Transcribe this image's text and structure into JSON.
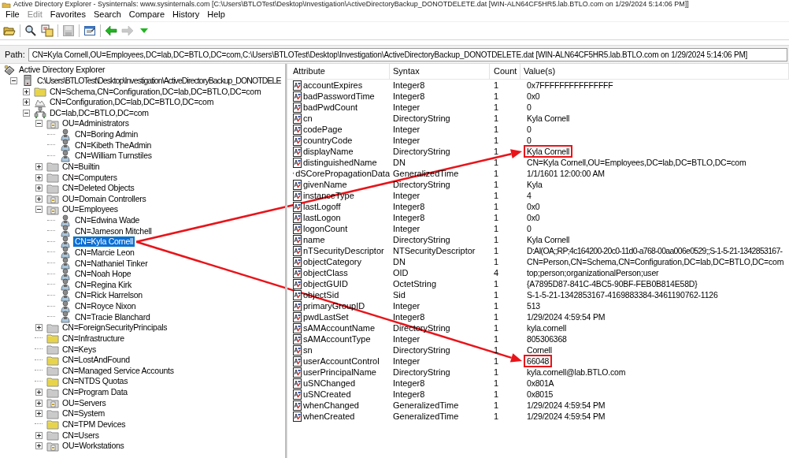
{
  "window": {
    "title": "Active Directory Explorer - Sysinternals: www.sysinternals.com [C:\\Users\\BTLOTest\\Desktop\\Investigation\\ActiveDirectoryBackup_DONOTDELETE.dat [WIN-ALN64CF5HR5.lab.BTLO.com on 1/29/2024 5:14:06 PM]]"
  },
  "menu": [
    {
      "label": "File",
      "disabled": false
    },
    {
      "label": "Edit",
      "disabled": true
    },
    {
      "label": "Favorites",
      "disabled": false
    },
    {
      "label": "Search",
      "disabled": false
    },
    {
      "label": "Compare",
      "disabled": false
    },
    {
      "label": "History",
      "disabled": false
    },
    {
      "label": "Help",
      "disabled": false
    }
  ],
  "toolbar": [
    {
      "kind": "open",
      "disabled": false
    },
    {
      "kind": "separator"
    },
    {
      "kind": "find",
      "disabled": false
    },
    {
      "kind": "compare",
      "disabled": false
    },
    {
      "kind": "separator"
    },
    {
      "kind": "save",
      "disabled": true
    },
    {
      "kind": "separator"
    },
    {
      "kind": "properties",
      "disabled": false
    },
    {
      "kind": "separator"
    },
    {
      "kind": "back",
      "disabled": false
    },
    {
      "kind": "forward",
      "disabled": true
    },
    {
      "kind": "history",
      "disabled": false
    }
  ],
  "path": {
    "label": "Path:",
    "value": "CN=Kyla Cornell,OU=Employees,DC=lab,DC=BTLO,DC=com,C:\\Users\\BTLOTest\\Desktop\\Investigation\\ActiveDirectoryBackup_DONOTDELETE.dat [WIN-ALN64CF5HR5.lab.BTLO.com on 1/29/2024 5:14:06 PM]"
  },
  "tree": [
    {
      "label": "Active Directory Explorer",
      "kind": "explorer",
      "selected": false,
      "children": [
        {
          "label": "C:\\Users\\BTLOTest\\Desktop\\Investigation\\ActiveDirectoryBackup_DONOTDELE",
          "kind": "database",
          "expanded": true,
          "selected": false,
          "children": [
            {
              "label": "CN=Schema,CN=Configuration,DC=lab,DC=BTLO,DC=com",
              "kind": "folder",
              "expanded": false,
              "selected": false
            },
            {
              "label": "CN=Configuration,DC=lab,DC=BTLO,DC=com",
              "kind": "config",
              "expanded": false,
              "selected": false
            },
            {
              "label": "DC=lab,DC=BTLO,DC=com",
              "kind": "domain",
              "expanded": true,
              "selected": false,
              "children": [
                {
                  "label": "OU=Administrators",
                  "kind": "ou",
                  "expanded": true,
                  "selected": false,
                  "children": [
                    {
                      "label": "CN=Boring Admin",
                      "kind": "user",
                      "selected": false
                    },
                    {
                      "label": "CN=Kibeth TheAdmin",
                      "kind": "user",
                      "selected": false
                    },
                    {
                      "label": "CN=William Turnstiles",
                      "kind": "user",
                      "selected": false
                    }
                  ]
                },
                {
                  "label": "CN=Builtin",
                  "kind": "container",
                  "expanded": false,
                  "selected": false
                },
                {
                  "label": "CN=Computers",
                  "kind": "container",
                  "expanded": false,
                  "selected": false
                },
                {
                  "label": "CN=Deleted Objects",
                  "kind": "container",
                  "expanded": false,
                  "selected": false
                },
                {
                  "label": "OU=Domain Controllers",
                  "kind": "ou",
                  "expanded": false,
                  "selected": false
                },
                {
                  "label": "OU=Employees",
                  "kind": "ou",
                  "expanded": true,
                  "selected": false,
                  "children": [
                    {
                      "label": "CN=Edwina Wade",
                      "kind": "user",
                      "selected": false
                    },
                    {
                      "label": "CN=Jameson Mitchell",
                      "kind": "user",
                      "selected": false
                    },
                    {
                      "label": "CN=Kyla Cornell",
                      "kind": "user",
                      "selected": true
                    },
                    {
                      "label": "CN=Marcie Leon",
                      "kind": "user",
                      "selected": false
                    },
                    {
                      "label": "CN=Nathaniel Tinker",
                      "kind": "user",
                      "selected": false
                    },
                    {
                      "label": "CN=Noah Hope",
                      "kind": "user",
                      "selected": false
                    },
                    {
                      "label": "CN=Regina Kirk",
                      "kind": "user",
                      "selected": false
                    },
                    {
                      "label": "CN=Rick Harrelson",
                      "kind": "user",
                      "selected": false
                    },
                    {
                      "label": "CN=Royce Nixon",
                      "kind": "user",
                      "selected": false
                    },
                    {
                      "label": "CN=Tracie Blanchard",
                      "kind": "user",
                      "selected": false
                    }
                  ]
                },
                {
                  "label": "CN=ForeignSecurityPrincipals",
                  "kind": "container",
                  "expanded": false,
                  "selected": false
                },
                {
                  "label": "CN=Infrastructure",
                  "kind": "folder",
                  "selected": false
                },
                {
                  "label": "CN=Keys",
                  "kind": "container",
                  "selected": false
                },
                {
                  "label": "CN=LostAndFound",
                  "kind": "folder",
                  "selected": false
                },
                {
                  "label": "CN=Managed Service Accounts",
                  "kind": "container",
                  "selected": false
                },
                {
                  "label": "CN=NTDS Quotas",
                  "kind": "folder",
                  "selected": false
                },
                {
                  "label": "CN=Program Data",
                  "kind": "container",
                  "expanded": false,
                  "selected": false
                },
                {
                  "label": "OU=Servers",
                  "kind": "ou",
                  "expanded": false,
                  "selected": false
                },
                {
                  "label": "CN=System",
                  "kind": "container",
                  "expanded": false,
                  "selected": false
                },
                {
                  "label": "CN=TPM Devices",
                  "kind": "folder",
                  "selected": false
                },
                {
                  "label": "CN=Users",
                  "kind": "container",
                  "expanded": false,
                  "selected": false
                },
                {
                  "label": "OU=Workstations",
                  "kind": "ou",
                  "expanded": false,
                  "selected": false
                }
              ]
            }
          ]
        }
      ]
    }
  ],
  "table": {
    "columns": [
      "Attribute",
      "Syntax",
      "Count",
      "Value(s)"
    ],
    "rows": [
      {
        "attribute": "accountExpires",
        "syntax": "Integer8",
        "count": "1",
        "value": "0x7FFFFFFFFFFFFFFF",
        "highlighted": false
      },
      {
        "attribute": "badPasswordTime",
        "syntax": "Integer8",
        "count": "1",
        "value": "0x0",
        "highlighted": false
      },
      {
        "attribute": "badPwdCount",
        "syntax": "Integer",
        "count": "1",
        "value": "0",
        "highlighted": false
      },
      {
        "attribute": "cn",
        "syntax": "DirectoryString",
        "count": "1",
        "value": "Kyla Cornell",
        "highlighted": false
      },
      {
        "attribute": "codePage",
        "syntax": "Integer",
        "count": "1",
        "value": "0",
        "highlighted": false
      },
      {
        "attribute": "countryCode",
        "syntax": "Integer",
        "count": "1",
        "value": "0",
        "highlighted": false
      },
      {
        "attribute": "displayName",
        "syntax": "DirectoryString",
        "count": "1",
        "value": "Kyla Cornell",
        "highlighted": true
      },
      {
        "attribute": "distinguishedName",
        "syntax": "DN",
        "count": "1",
        "value": "CN=Kyla Cornell,OU=Employees,DC=lab,DC=BTLO,DC=com",
        "highlighted": false
      },
      {
        "attribute": "dSCorePropagationData",
        "syntax": "GeneralizedTime",
        "count": "1",
        "value": "1/1/1601 12:00:00 AM",
        "highlighted": false
      },
      {
        "attribute": "givenName",
        "syntax": "DirectoryString",
        "count": "1",
        "value": "Kyla",
        "highlighted": false
      },
      {
        "attribute": "instanceType",
        "syntax": "Integer",
        "count": "1",
        "value": "4",
        "highlighted": false
      },
      {
        "attribute": "lastLogoff",
        "syntax": "Integer8",
        "count": "1",
        "value": "0x0",
        "highlighted": false
      },
      {
        "attribute": "lastLogon",
        "syntax": "Integer8",
        "count": "1",
        "value": "0x0",
        "highlighted": false
      },
      {
        "attribute": "logonCount",
        "syntax": "Integer",
        "count": "1",
        "value": "0",
        "highlighted": false
      },
      {
        "attribute": "name",
        "syntax": "DirectoryString",
        "count": "1",
        "value": "Kyla Cornell",
        "highlighted": false
      },
      {
        "attribute": "nTSecurityDescriptor",
        "syntax": "NTSecurityDescriptor",
        "count": "1",
        "value": "D:AI(OA;;RP;4c164200-20c0-11d0-a768-00aa006e0529;;S-1-5-21-1342853167-",
        "highlighted": false
      },
      {
        "attribute": "objectCategory",
        "syntax": "DN",
        "count": "1",
        "value": "CN=Person,CN=Schema,CN=Configuration,DC=lab,DC=BTLO,DC=com",
        "highlighted": false
      },
      {
        "attribute": "objectClass",
        "syntax": "OID",
        "count": "4",
        "value": "top;person;organizationalPerson;user",
        "highlighted": false
      },
      {
        "attribute": "objectGUID",
        "syntax": "OctetString",
        "count": "1",
        "value": "{A7895D87-841C-4BC5-90BF-FEB0B814E58D}",
        "highlighted": false
      },
      {
        "attribute": "objectSid",
        "syntax": "Sid",
        "count": "1",
        "value": "S-1-5-21-1342853167-4169883384-3461190762-1126",
        "highlighted": false
      },
      {
        "attribute": "primaryGroupID",
        "syntax": "Integer",
        "count": "1",
        "value": "513",
        "highlighted": false
      },
      {
        "attribute": "pwdLastSet",
        "syntax": "Integer8",
        "count": "1",
        "value": "1/29/2024 4:59:54 PM",
        "highlighted": false
      },
      {
        "attribute": "sAMAccountName",
        "syntax": "DirectoryString",
        "count": "1",
        "value": "kyla.cornell",
        "highlighted": false
      },
      {
        "attribute": "sAMAccountType",
        "syntax": "Integer",
        "count": "1",
        "value": "805306368",
        "highlighted": false
      },
      {
        "attribute": "sn",
        "syntax": "DirectoryString",
        "count": "1",
        "value": "Cornell",
        "highlighted": false
      },
      {
        "attribute": "userAccountControl",
        "syntax": "Integer",
        "count": "1",
        "value": "66048",
        "highlighted": true
      },
      {
        "attribute": "userPrincipalName",
        "syntax": "DirectoryString",
        "count": "1",
        "value": "kyla.cornell@lab.BTLO.com",
        "highlighted": false
      },
      {
        "attribute": "uSNChanged",
        "syntax": "Integer8",
        "count": "1",
        "value": "0x801A",
        "highlighted": false
      },
      {
        "attribute": "uSNCreated",
        "syntax": "Integer8",
        "count": "1",
        "value": "0x8015",
        "highlighted": false
      },
      {
        "attribute": "whenChanged",
        "syntax": "GeneralizedTime",
        "count": "1",
        "value": "1/29/2024 4:59:54 PM",
        "highlighted": false
      },
      {
        "attribute": "whenCreated",
        "syntax": "GeneralizedTime",
        "count": "1",
        "value": "1/29/2024 4:59:54 PM",
        "highlighted": false
      }
    ]
  }
}
